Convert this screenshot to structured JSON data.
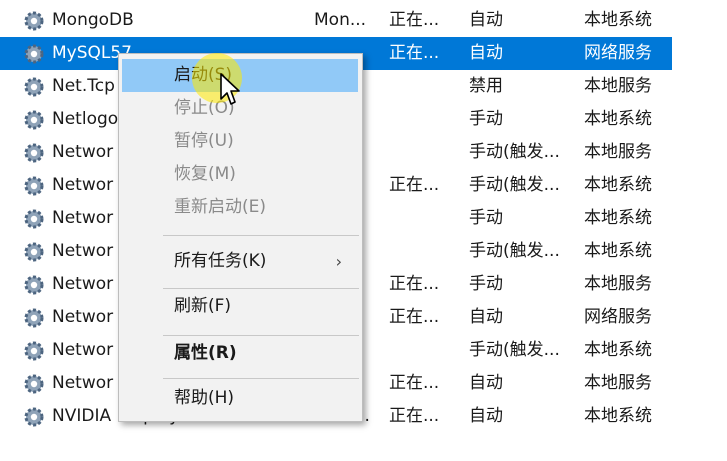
{
  "services": [
    {
      "name": "MongoDB",
      "desc": "Mon...",
      "status": "正在...",
      "startup": "自动",
      "logon": "本地系统"
    },
    {
      "name": "MySQL57",
      "desc": "",
      "status": "正在...",
      "startup": "自动",
      "logon": "网络服务",
      "selected": true
    },
    {
      "name": "Net.Tcp",
      "desc": "",
      "status": "",
      "startup": "禁用",
      "logon": "本地服务"
    },
    {
      "name": "Netlogo",
      "desc": "",
      "status": "",
      "startup": "手动",
      "logon": "本地系统"
    },
    {
      "name": "Networ",
      "desc": "",
      "status": "",
      "startup": "手动(触发...",
      "logon": "本地服务"
    },
    {
      "name": "Networ",
      "desc": "",
      "status": "正在...",
      "startup": "手动(触发...",
      "logon": "本地系统"
    },
    {
      "name": "Networ",
      "desc": "",
      "status": "",
      "startup": "手动",
      "logon": "本地系统"
    },
    {
      "name": "Networ",
      "desc": "",
      "status": "",
      "startup": "手动(触发...",
      "logon": "本地系统"
    },
    {
      "name": "Networ",
      "desc": "",
      "status": "正在...",
      "startup": "手动",
      "logon": "本地服务"
    },
    {
      "name": "Networ",
      "desc": "",
      "status": "正在...",
      "startup": "自动",
      "logon": "网络服务"
    },
    {
      "name": "Networ",
      "desc": "",
      "status": "",
      "startup": "手动(触发...",
      "logon": "本地系统"
    },
    {
      "name": "Networ",
      "desc": "",
      "status": "正在...",
      "startup": "自动",
      "logon": "本地服务"
    },
    {
      "name": "NVIDIA Display Container LS",
      "desc": "Cont...",
      "status": "正在...",
      "startup": "自动",
      "logon": "本地系统"
    }
  ],
  "context_menu": {
    "items": [
      {
        "label": "启动(S)",
        "enabled": true,
        "highlighted": true
      },
      {
        "label": "停止(O)",
        "enabled": false
      },
      {
        "label": "暂停(U)",
        "enabled": false
      },
      {
        "label": "恢复(M)",
        "enabled": false
      },
      {
        "label": "重新启动(E)",
        "enabled": false
      },
      {
        "label": "所有任务(K)",
        "enabled": true,
        "submenu": true
      },
      {
        "label": "刷新(F)",
        "enabled": true
      },
      {
        "label": "属性(R)",
        "enabled": true,
        "bold": true
      },
      {
        "label": "帮助(H)",
        "enabled": true
      }
    ],
    "submenu_arrow": "›"
  },
  "colors": {
    "selection": "#0078d7",
    "menu_background": "#f2f2f2",
    "menu_highlight": "#91c9f7",
    "disabled_text": "#8a8a8a"
  },
  "icons": {
    "service": "gear-icon",
    "cursor": "pointer-cursor-icon"
  }
}
